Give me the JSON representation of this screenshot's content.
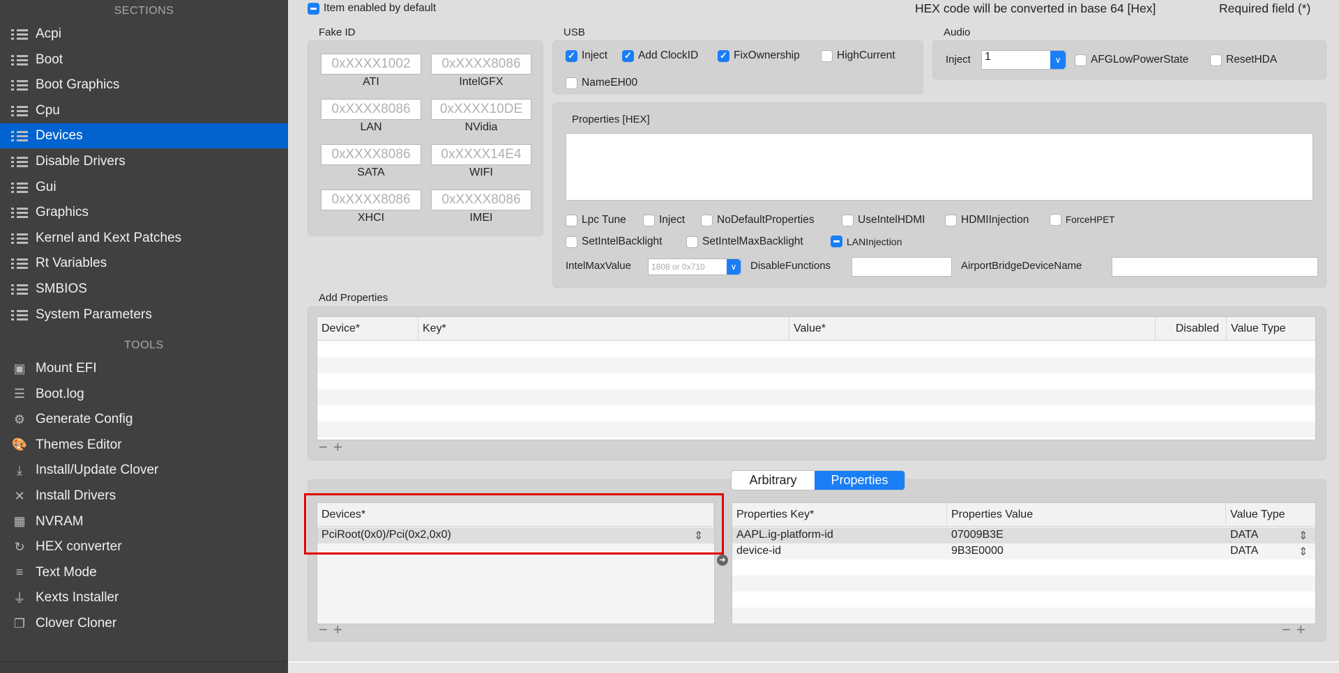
{
  "sidebar": {
    "sections_header": "SECTIONS",
    "sections": [
      "Acpi",
      "Boot",
      "Boot Graphics",
      "Cpu",
      "Devices",
      "Disable Drivers",
      "Gui",
      "Graphics",
      "Kernel and Kext Patches",
      "Rt Variables",
      "SMBIOS",
      "System Parameters"
    ],
    "selected": "Devices",
    "tools_header": "TOOLS",
    "tools": [
      {
        "label": "Mount EFI",
        "icon": "disk-icon"
      },
      {
        "label": "Boot.log",
        "icon": "log-search-icon"
      },
      {
        "label": "Generate Config",
        "icon": "gears-icon"
      },
      {
        "label": "Themes Editor",
        "icon": "palette-icon"
      },
      {
        "label": "Install/Update Clover",
        "icon": "download-icon"
      },
      {
        "label": "Install Drivers",
        "icon": "tools-icon"
      },
      {
        "label": "NVRAM",
        "icon": "chip-icon"
      },
      {
        "label": "HEX converter",
        "icon": "refresh-icon"
      },
      {
        "label": "Text Mode",
        "icon": "text-icon"
      },
      {
        "label": "Kexts Installer",
        "icon": "plug-icon"
      },
      {
        "label": "Clover Cloner",
        "icon": "copy-icon"
      }
    ]
  },
  "header": {
    "item_enabled": "Item enabled by default",
    "hex_note": "HEX code will be converted in base 64 [Hex]",
    "required_note": "Required field (*)"
  },
  "fake_id": {
    "title": "Fake ID",
    "fields": [
      {
        "label": "ATI",
        "placeholder": "0xXXXX1002"
      },
      {
        "label": "IntelGFX",
        "placeholder": "0xXXXX8086"
      },
      {
        "label": "LAN",
        "placeholder": "0xXXXX8086"
      },
      {
        "label": "NVidia",
        "placeholder": "0xXXXX10DE"
      },
      {
        "label": "SATA",
        "placeholder": "0xXXXX8086"
      },
      {
        "label": "WIFI",
        "placeholder": "0xXXXX14E4"
      },
      {
        "label": "XHCI",
        "placeholder": "0xXXXX8086"
      },
      {
        "label": "IMEI",
        "placeholder": "0xXXXX8086"
      }
    ]
  },
  "usb": {
    "title": "USB",
    "inject": "Inject",
    "add_clockid": "Add ClockID",
    "fix_ownership": "FixOwnership",
    "high_current": "HighCurrent",
    "name_eh00": "NameEH00"
  },
  "audio": {
    "title": "Audio",
    "inject_label": "Inject",
    "inject_value": "1",
    "afg": "AFGLowPowerState",
    "reset_hda": "ResetHDA"
  },
  "properties_hex": {
    "title": "Properties [HEX]",
    "options": [
      "Lpc Tune",
      "Inject",
      "NoDefaultProperties",
      "UseIntelHDMI",
      "HDMIInjection",
      "ForceHPET"
    ],
    "options2": [
      "SetIntelBacklight",
      "SetIntelMaxBacklight",
      "LANInjection"
    ],
    "intel_max_label": "IntelMaxValue",
    "intel_max_placeholder": "1808 or 0x710",
    "disable_functions": "DisableFunctions",
    "airport": "AirportBridgeDeviceName"
  },
  "add_properties": {
    "title": "Add Properties",
    "columns": [
      "Device*",
      "Key*",
      "Value*",
      "Disabled",
      "Value Type"
    ]
  },
  "tabs": {
    "arbitrary": "Arbitrary",
    "properties": "Properties",
    "active": "Properties"
  },
  "devices": {
    "columns": [
      "Devices*"
    ],
    "rows": [
      "PciRoot(0x0)/Pci(0x2,0x0)"
    ]
  },
  "props": {
    "columns": [
      "Properties Key*",
      "Properties Value",
      "Value Type"
    ],
    "rows": [
      {
        "key": "AAPL.ig-platform-id",
        "value": "07009B3E",
        "type": "DATA"
      },
      {
        "key": "device-id",
        "value": "9B3E0000",
        "type": "DATA"
      }
    ]
  },
  "colors": {
    "accent": "#1a7ef5",
    "sidebar": "#404040",
    "highlight": "#e00000"
  }
}
